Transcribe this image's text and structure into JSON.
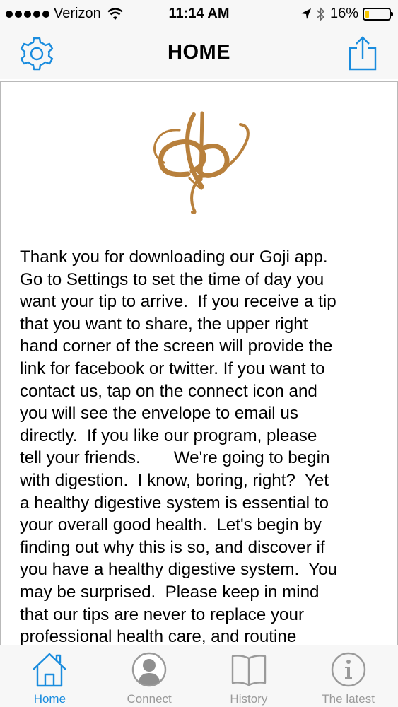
{
  "status_bar": {
    "carrier": "Verizon",
    "time": "11:14 AM",
    "battery": "16%",
    "battery_level": 0.16
  },
  "nav": {
    "title": "HOME",
    "left_icon": "gear-icon",
    "right_icon": "share-icon"
  },
  "content": {
    "logo": "db-monogram-logo",
    "text": "Thank you for downloading our Goji app.\nGo to Settings to set the time of day you\nwant your tip to arrive.  If you receive a tip\nthat you want to share, the upper right\nhand corner of the screen will provide the\nlink for facebook or twitter. If you want to\ncontact us, tap on the connect icon and\nyou will see the envelope to email us\ndirectly.  If you like our program, please\ntell your friends.       We're going to begin\nwith digestion.  I know, boring, right?  Yet\na healthy digestive system is essential to\nyour overall good health.  Let's begin by\nfinding out why this is so, and discover if\nyou have a healthy digestive system.  You\nmay be surprised.  Please keep in mind\nthat our tips are never to replace your\nprofessional health care, and routine"
  },
  "tabs": [
    {
      "label": "Home",
      "icon": "home-icon",
      "active": true
    },
    {
      "label": "Connect",
      "icon": "person-icon",
      "active": false
    },
    {
      "label": "History",
      "icon": "book-icon",
      "active": false
    },
    {
      "label": "The latest",
      "icon": "info-icon",
      "active": false
    }
  ],
  "colors": {
    "accent": "#1a8cde",
    "inactive": "#9a9a9a",
    "logo_gold": "#b8803c"
  }
}
